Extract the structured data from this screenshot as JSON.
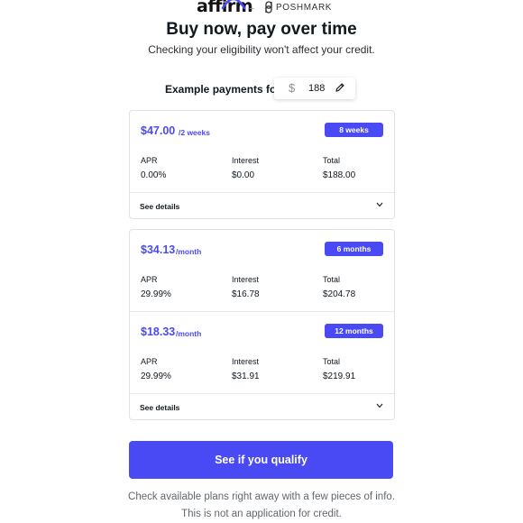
{
  "header": {
    "partner_logo_text": "affirm",
    "plus": "+",
    "merchant_logo_text": "POSHMARK"
  },
  "title": "Buy now, pay over time",
  "subtitle": "Checking your eligibility won't affect your credit.",
  "example": {
    "label": "Example payments for",
    "currency_symbol": "$",
    "amount": "188"
  },
  "plans": [
    {
      "price": "$47.00",
      "period": "/2 weeks",
      "term": "8 weeks",
      "apr_label": "APR",
      "apr": "0.00%",
      "interest_label": "Interest",
      "interest": "$0.00",
      "total_label": "Total",
      "total": "$188.00"
    },
    {
      "price": "$34.13",
      "period": "/month",
      "term": "6 months",
      "apr_label": "APR",
      "apr": "29.99%",
      "interest_label": "Interest",
      "interest": "$16.78",
      "total_label": "Total",
      "total": "$204.78"
    },
    {
      "price": "$18.33",
      "period": "/month",
      "term": "12 months",
      "apr_label": "APR",
      "apr": "29.99%",
      "interest_label": "Interest",
      "interest": "$31.91",
      "total_label": "Total",
      "total": "$219.91"
    }
  ],
  "see_details_label": "See details",
  "cta_label": "See if you qualify",
  "footer": {
    "line1": "Check available plans right away with a few pieces of info.",
    "line2": "This is not an application for credit."
  },
  "colors": {
    "accent": "#4a4af4",
    "text": "#101820",
    "muted": "#62676d"
  }
}
